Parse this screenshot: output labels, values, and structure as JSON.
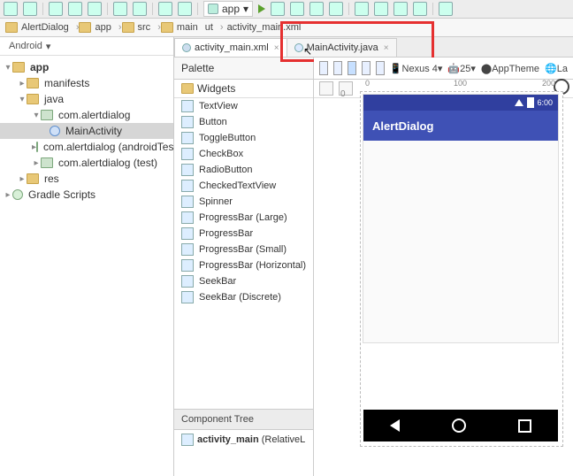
{
  "toolbar": {
    "run_config": "app"
  },
  "breadcrumb": {
    "c0": "AlertDialog",
    "c1": "app",
    "c2": "src",
    "c3": "main",
    "c4": "ut",
    "c5": "activity_main.xml"
  },
  "sidebar": {
    "view": "Android",
    "app": "app",
    "manifests": "manifests",
    "java": "java",
    "pkg": "com.alertdialog",
    "main_activity": "MainActivity",
    "pkg_android_test": "com.alertdialog (androidTest)",
    "pkg_test": "com.alertdialog (test)",
    "res": "res",
    "gradle": "Gradle Scripts"
  },
  "tabs": {
    "t1": "activity_main.xml",
    "t2": "MainActivity.java"
  },
  "design_bar": {
    "device": "Nexus 4",
    "api": "25",
    "theme": "AppTheme",
    "loc": "La"
  },
  "palette": {
    "title": "Palette",
    "section": "Widgets",
    "items": {
      "textview": "TextView",
      "button": "Button",
      "togglebutton": "ToggleButton",
      "checkbox": "CheckBox",
      "radiobutton": "RadioButton",
      "checkedtextview": "CheckedTextView",
      "spinner": "Spinner",
      "progress_large": "ProgressBar (Large)",
      "progressbar": "ProgressBar",
      "progress_small": "ProgressBar (Small)",
      "progress_horizontal": "ProgressBar (Horizontal)",
      "seekbar": "SeekBar",
      "seekbar_discrete": "SeekBar (Discrete)"
    }
  },
  "component_tree": {
    "title": "Component Tree",
    "root_bold": "activity_main",
    "root_rest": " (RelativeL"
  },
  "preview": {
    "clock": "6:00",
    "app_title": "AlertDialog"
  },
  "ruler": {
    "r0": "0",
    "r1": "100",
    "r2": "200"
  }
}
